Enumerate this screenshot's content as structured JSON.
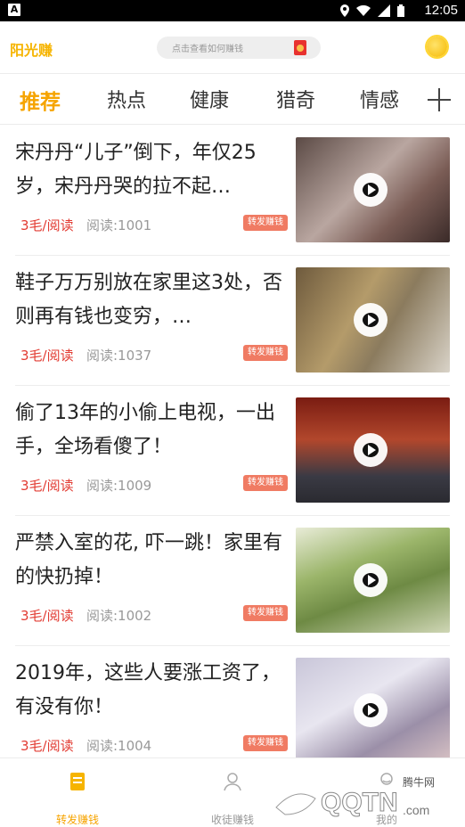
{
  "status_bar": {
    "time": "12:05",
    "left_glyph": "A"
  },
  "header": {
    "app_name": "阳光赚",
    "search_hint": "点击查看如何赚钱"
  },
  "tabs": [
    "推荐",
    "热点",
    "健康",
    "猎奇",
    "情感"
  ],
  "feed": [
    {
      "title": "宋丹丹“儿子”倒下，年仅25岁，宋丹丹哭的拉不起…",
      "price": "3毛/阅读",
      "reads": "阅读:1001",
      "badge": "转发赚钱"
    },
    {
      "title": "鞋子万万别放在家里这3处，否则再有钱也变穷，…",
      "price": "3毛/阅读",
      "reads": "阅读:1037",
      "badge": "转发赚钱"
    },
    {
      "title": "偷了13年的小偷上电视，一出手，全场看傻了！",
      "price": "3毛/阅读",
      "reads": "阅读:1009",
      "badge": "转发赚钱"
    },
    {
      "title": "严禁入室的花, 吓一跳！家里有的快扔掉！",
      "price": "3毛/阅读",
      "reads": "阅读:1002",
      "badge": "转发赚钱"
    },
    {
      "title": "2019年，这些人要涨工资了，有没有你！",
      "price": "3毛/阅读",
      "reads": "阅读:1004",
      "badge": "转发赚钱"
    }
  ],
  "bottom_nav": [
    {
      "label": "转发赚钱",
      "icon": "document-icon",
      "active": true
    },
    {
      "label": "收徒赚钱",
      "icon": "users-icon",
      "active": false
    },
    {
      "label": "我的",
      "icon": "user-icon",
      "active": false
    }
  ],
  "watermark": {
    "site": "QQTN",
    "suffix": ".com",
    "tag": "腾牛网"
  },
  "colors": {
    "accent": "#f6a400",
    "price": "#e23b32",
    "badge": "#f07b63"
  }
}
